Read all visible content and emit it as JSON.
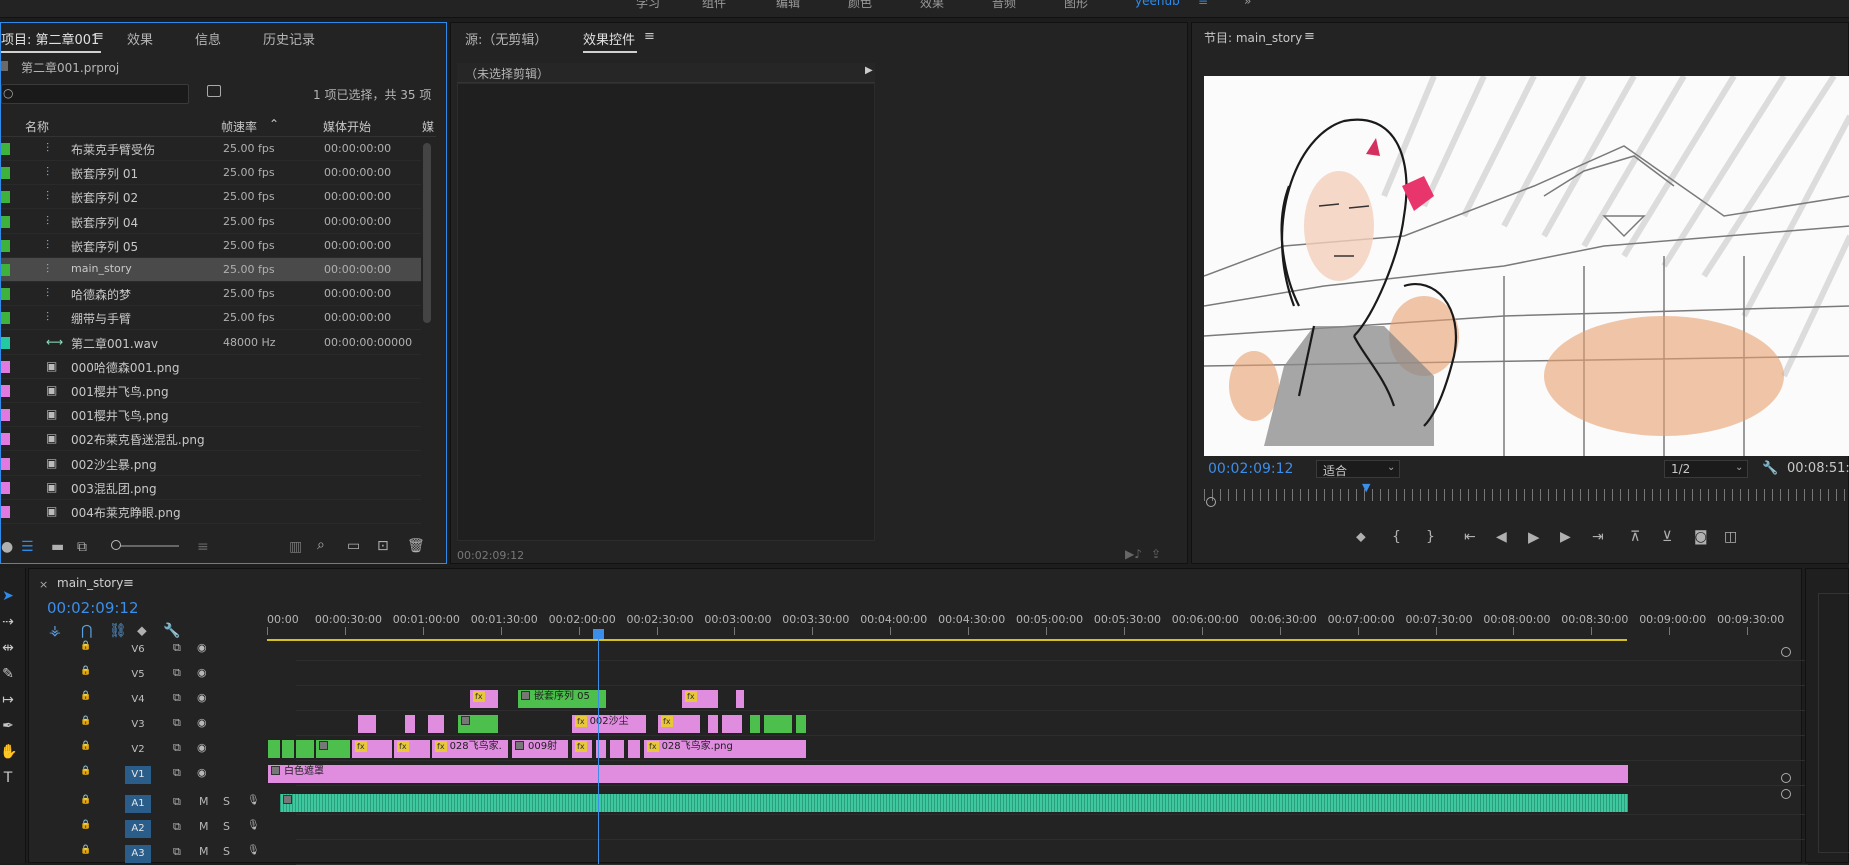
{
  "workspaces": [
    "学习",
    "组件",
    "编辑",
    "颜色",
    "效果",
    "音频",
    "图形",
    "yeehub"
  ],
  "workspace_active": 7,
  "project_panel": {
    "tabs": [
      "项目: 第二章001",
      "效果",
      "信息",
      "历史记录"
    ],
    "project_file": "第二章001.prproj",
    "selection_info": "1 项已选择，共 35 项",
    "columns": [
      "名称",
      "帧速率",
      "媒体开始",
      "媒"
    ],
    "items": [
      {
        "name": "布莱克手臂受伤",
        "rate": "25.00 fps",
        "start": "00:00:00:00",
        "color": "#3db33d",
        "type": "sequence"
      },
      {
        "name": "嵌套序列 01",
        "rate": "25.00 fps",
        "start": "00:00:00:00",
        "color": "#3db33d",
        "type": "sequence"
      },
      {
        "name": "嵌套序列 02",
        "rate": "25.00 fps",
        "start": "00:00:00:00",
        "color": "#3db33d",
        "type": "sequence"
      },
      {
        "name": "嵌套序列 04",
        "rate": "25.00 fps",
        "start": "00:00:00:00",
        "color": "#3db33d",
        "type": "sequence"
      },
      {
        "name": "嵌套序列 05",
        "rate": "25.00 fps",
        "start": "00:00:00:00",
        "color": "#3db33d",
        "type": "sequence"
      },
      {
        "name": "main_story",
        "rate": "25.00 fps",
        "start": "00:00:00:00",
        "color": "#3db33d",
        "type": "sequence",
        "selected": true
      },
      {
        "name": "哈德森的梦",
        "rate": "25.00 fps",
        "start": "00:00:00:00",
        "color": "#3db33d",
        "type": "sequence"
      },
      {
        "name": "绷带与手臂",
        "rate": "25.00 fps",
        "start": "00:00:00:00",
        "color": "#3db33d",
        "type": "sequence"
      },
      {
        "name": "第二章001.wav",
        "rate": "48000 Hz",
        "start": "00:00:00:00000",
        "color": "#23c9a0",
        "type": "audio"
      },
      {
        "name": "000哈德森001.png",
        "rate": "",
        "start": "",
        "color": "#e07ae0",
        "type": "image"
      },
      {
        "name": "001樱井飞鸟.png",
        "rate": "",
        "start": "",
        "color": "#e07ae0",
        "type": "image"
      },
      {
        "name": "001樱井飞鸟.png",
        "rate": "",
        "start": "",
        "color": "#e07ae0",
        "type": "image"
      },
      {
        "name": "002布莱克昏迷混乱.png",
        "rate": "",
        "start": "",
        "color": "#e07ae0",
        "type": "image"
      },
      {
        "name": "002沙尘暴.png",
        "rate": "",
        "start": "",
        "color": "#e07ae0",
        "type": "image"
      },
      {
        "name": "003混乱团.png",
        "rate": "",
        "start": "",
        "color": "#e07ae0",
        "type": "image"
      },
      {
        "name": "004布莱克睁眼.png",
        "rate": "",
        "start": "",
        "color": "#e07ae0",
        "type": "image"
      }
    ]
  },
  "source_panel": {
    "tabs": [
      "源:（无剪辑）",
      "效果控件"
    ],
    "no_clip": "（未选择剪辑）",
    "timecode": "00:02:09:12"
  },
  "program_panel": {
    "title": "节目: main_story",
    "timecode": "00:02:09:12",
    "fit": "适合",
    "resolution": "1/2",
    "duration": "00:08:51:"
  },
  "timeline": {
    "tab": "main_story",
    "timecode": "00:02:09:12",
    "ruler": [
      "00:00",
      "00:00:30:00",
      "00:01:00:00",
      "00:01:30:00",
      "00:02:00:00",
      "00:02:30:00",
      "00:03:00:00",
      "00:03:30:00",
      "00:04:00:00",
      "00:04:30:00",
      "00:05:00:00",
      "00:05:30:00",
      "00:06:00:00",
      "00:06:30:00",
      "00:07:00:00",
      "00:07:30:00",
      "00:08:00:00",
      "00:08:30:00",
      "00:09:00:00",
      "00:09:30:00"
    ],
    "video_tracks": [
      "V6",
      "V5",
      "V4",
      "V3",
      "V2",
      "V1"
    ],
    "audio_tracks": [
      "A1",
      "A2",
      "A3"
    ],
    "mute": "M",
    "solo": "S",
    "clips": {
      "v4_a": "嵌套序列 05",
      "v3_a": "002沙尘",
      "v2_a": "028飞鸟家.",
      "v2_b": "009射",
      "v2_c": "028飞鸟家.png",
      "v1": "白色遮罩"
    },
    "fx": "fx"
  },
  "colors": {
    "accent": "#2d8ceb",
    "pink": "#e08de0",
    "green": "#4cbf4c",
    "audio": "#3fc8a0"
  }
}
